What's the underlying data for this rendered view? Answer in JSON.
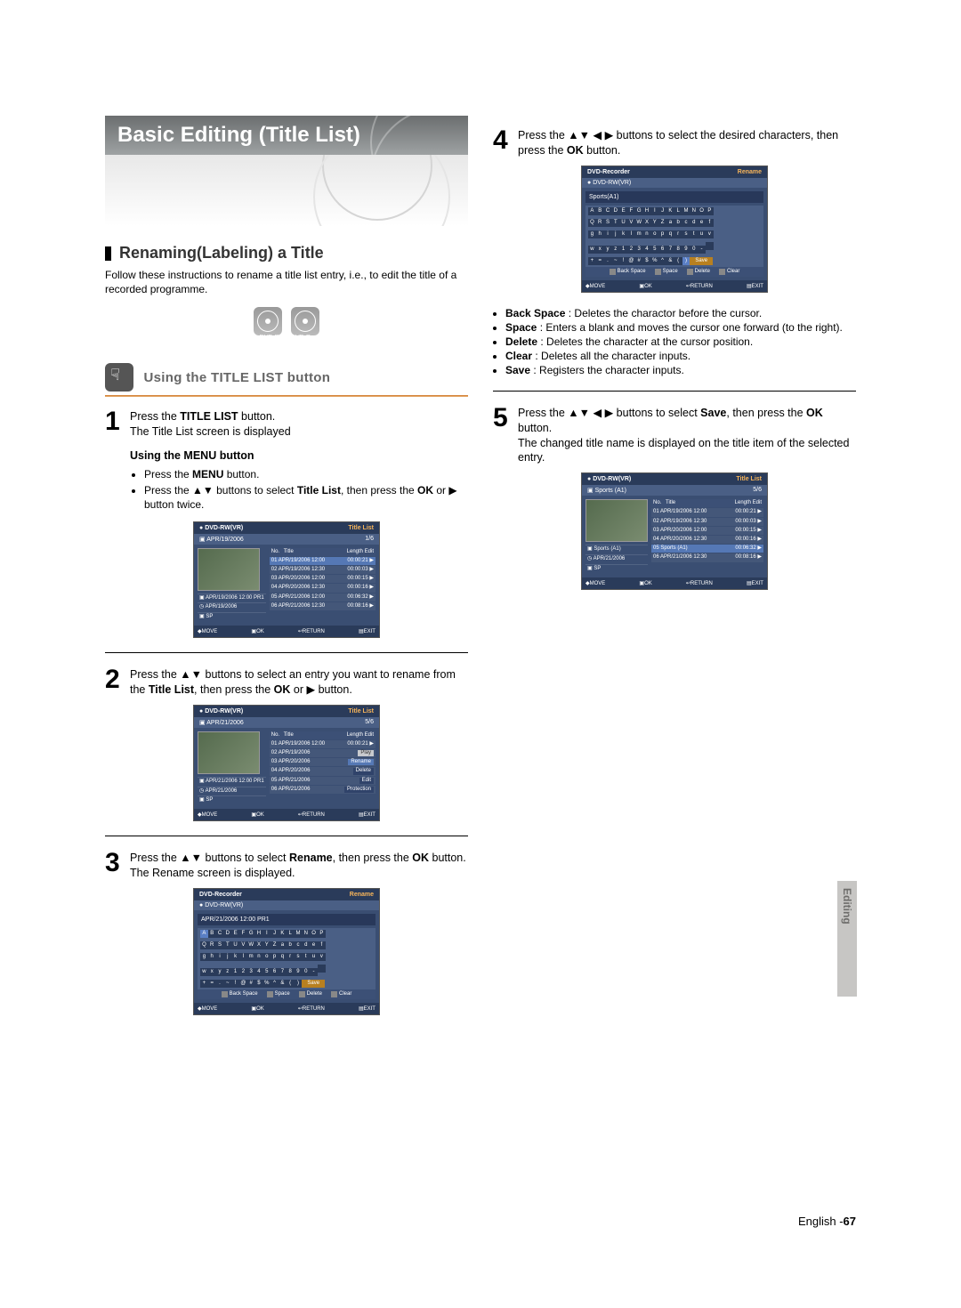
{
  "title": "Basic Editing (Title List)",
  "section": "Renaming(Labeling) a Title",
  "intro": "Follow these instructions to rename a title list entry, i.e., to edit the title of a recorded programme.",
  "discs": [
    "DVD-RW",
    "DVD-R"
  ],
  "method": "Using the TITLE LIST button",
  "steps": [
    {
      "n": "1",
      "btn": "TITLE LIST",
      "note": "The Title List screen is displayed",
      "subhdr": "Using the MENU button",
      "menu": "MENU",
      "tl": "Title List",
      "ok": "OK"
    },
    {
      "n": "2",
      "tl": "Title List",
      "ok": "OK"
    },
    {
      "n": "3",
      "sel": "Rename",
      "ok": "OK",
      "note": "The Rename screen is displayed."
    },
    {
      "n": "4",
      "ok": "OK"
    },
    {
      "n": "5",
      "sel": "Save",
      "ok": "OK",
      "note": "The changed title name is displayed on the title item of the selected entry."
    }
  ],
  "defs": [
    {
      "k": "Back Space",
      "v": "Deletes the charactor before the cursor."
    },
    {
      "k": "Space",
      "v": "Enters a blank and moves the cursor one forward (to the right)."
    },
    {
      "k": "Delete",
      "v": "Deletes the character at the cursor position."
    },
    {
      "k": "Clear",
      "v": "Deletes all the character inputs."
    },
    {
      "k": "Save",
      "v": "Registers the character inputs."
    }
  ],
  "osd": {
    "mode": "DVD-RW(VR)",
    "titlelist": "Title List",
    "rename": "Rename",
    "recorder": "DVD-Recorder",
    "cols": [
      "No.",
      "Title",
      "Length Edit"
    ],
    "ctrl": {
      "move": "MOVE",
      "ok": "OK",
      "return": "RETURN",
      "exit": "EXIT"
    },
    "kbtn": [
      "Back Space",
      "Space",
      "Delete",
      "Clear"
    ],
    "keyb": [
      [
        "A",
        "B",
        "C",
        "D",
        "E",
        "F",
        "G",
        "H",
        "I",
        "J",
        "K",
        "L",
        "M",
        "N",
        "O",
        "P"
      ],
      [
        "Q",
        "R",
        "S",
        "T",
        "U",
        "V",
        "W",
        "X",
        "Y",
        "Z",
        "a",
        "b",
        "c",
        "d",
        "e",
        "f"
      ],
      [
        "g",
        "h",
        "i",
        "j",
        "k",
        "l",
        "m",
        "n",
        "o",
        "p",
        "q",
        "r",
        "s",
        "t",
        "u",
        "v"
      ],
      [
        "w",
        "x",
        "y",
        "z",
        "1",
        "2",
        "3",
        "4",
        "5",
        "6",
        "7",
        "8",
        "9",
        "0",
        "-",
        " "
      ],
      [
        "+",
        "=",
        ".",
        "~",
        "!",
        "@",
        "#",
        "$",
        "%",
        "^",
        "&",
        "(",
        ")"
      ]
    ],
    "save": "Save"
  },
  "osd1": {
    "date": "APR/19/2006",
    "page": "1/6",
    "rec": "APR/19/2006 12:00 PR1",
    "date2": "APR/19/2006",
    "sp": "SP",
    "rows": [
      {
        "t": "01 APR/19/2006 12:00",
        "d": "00:00:21 ▶"
      },
      {
        "t": "02 APR/19/2006 12:30",
        "d": "00:00:03 ▶"
      },
      {
        "t": "03 APR/20/2006 12:00",
        "d": "00:00:15 ▶"
      },
      {
        "t": "04 APR/20/2006 12:30",
        "d": "00:00:16 ▶"
      },
      {
        "t": "05 APR/21/2006 12:00",
        "d": "00:06:32 ▶"
      },
      {
        "t": "06 APR/21/2006 12:30",
        "d": "00:08:16 ▶"
      }
    ]
  },
  "osd2": {
    "date": "APR/21/2006",
    "page": "5/6",
    "rec": "APR/21/2006 12:00 PR1",
    "date2": "APR/21/2006",
    "sp": "SP",
    "rows": [
      {
        "t": "01 APR/19/2006 12:00",
        "d": "00:00:21 ▶"
      },
      {
        "t": "02 APR/19/2006"
      },
      {
        "t": "03 APR/20/2006"
      },
      {
        "t": "04 APR/20/2006"
      },
      {
        "t": "05 APR/21/2006"
      },
      {
        "t": "06 APR/21/2006"
      }
    ],
    "menu": [
      "Play",
      "Rename",
      "Delete",
      "Edit",
      "Protection"
    ]
  },
  "osd3": {
    "text": "APR/21/2006 12:00 PR1"
  },
  "osd4": {
    "text": "Sports(A1)"
  },
  "osd5": {
    "date": "Sports (A1)",
    "page": "5/6",
    "name": "Sports (A1)",
    "date2": "APR/21/2006",
    "sp": "SP",
    "rows": [
      {
        "t": "01 APR/19/2006 12:00",
        "d": "00:00:21 ▶"
      },
      {
        "t": "02 APR/19/2006 12:30",
        "d": "00:00:03 ▶"
      },
      {
        "t": "03 APR/20/2006 12:00",
        "d": "00:00:15 ▶"
      },
      {
        "t": "04 APR/20/2006 12:30",
        "d": "00:00:16 ▶"
      },
      {
        "t": "05 Sports (A1)",
        "d": "00:06:32 ▶"
      },
      {
        "t": "06 APR/21/2006 12:30",
        "d": "00:08:16 ▶"
      }
    ]
  },
  "sideTab": "Editing",
  "footer": {
    "lang": "English",
    "page": "67"
  }
}
